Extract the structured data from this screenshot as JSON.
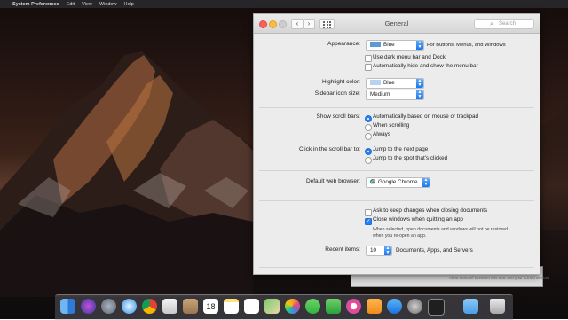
{
  "menubar": {
    "app_name": "System Preferences",
    "items": [
      "Edit",
      "View",
      "Window",
      "Help"
    ],
    "right": [
      "",
      ""
    ]
  },
  "window": {
    "title": "General",
    "search_placeholder": "Search"
  },
  "appearance": {
    "label": "Appearance:",
    "value": "Blue",
    "swatch_color": "#5b9bd5",
    "note": "For Buttons, Menus, and Windows",
    "dark_menu_label": "Use dark menu bar and Dock",
    "dark_menu_checked": false,
    "autohide_label": "Automatically hide and show the menu bar",
    "autohide_checked": false
  },
  "highlight": {
    "label": "Highlight color:",
    "value": "Blue",
    "swatch_color": "#b8d3f2"
  },
  "sidebar_size": {
    "label": "Sidebar icon size:",
    "value": "Medium"
  },
  "scroll_bars": {
    "label": "Show scroll bars:",
    "options": [
      "Automatically based on mouse or trackpad",
      "When scrolling",
      "Always"
    ],
    "selected": 0
  },
  "click_scroll": {
    "label": "Click in the scroll bar to:",
    "options": [
      "Jump to the next page",
      "Jump to the spot that's clicked"
    ],
    "selected": 0
  },
  "browser": {
    "label": "Default web browser:",
    "value": "Google Chrome"
  },
  "documents": {
    "ask_label": "Ask to keep changes when closing documents",
    "ask_checked": false,
    "close_label": "Close windows when quitting an app",
    "close_checked": true,
    "note_line1": "When selected, open documents and windows will not be restored",
    "note_line2": "when you re-open an app."
  },
  "recent": {
    "label": "Recent items:",
    "value": "10",
    "suffix": "Documents, Apps, and Servers"
  },
  "behind_panel": {
    "text": "Allow Handoff between this Mac and your iCloud devices"
  },
  "dock": {
    "icons": [
      "finder-icon",
      "siri-icon",
      "launchpad-icon",
      "safari-icon",
      "chrome-icon",
      "mail-icon",
      "contacts-icon",
      "calendar-icon",
      "notes-icon",
      "reminders-icon",
      "maps-icon",
      "photos-icon",
      "messages-icon",
      "facetime-icon",
      "itunes-icon",
      "ibooks-icon",
      "app-store-icon",
      "system-preferences-icon",
      "terminal-icon",
      "folder-icon",
      "trash-icon"
    ],
    "calendar_day": "18"
  }
}
